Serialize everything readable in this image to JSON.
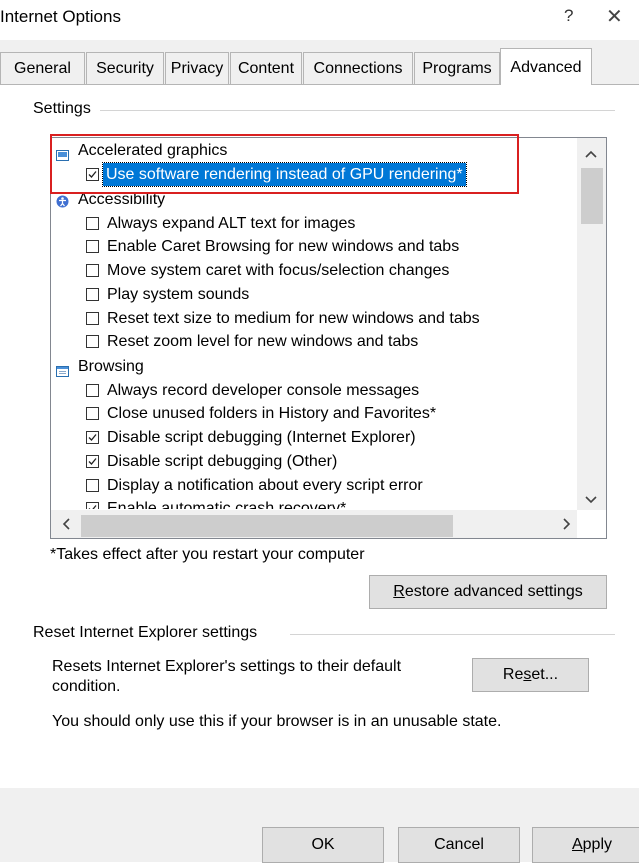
{
  "window": {
    "title": "Internet Options",
    "help_glyph": "?",
    "close_glyph": "✕"
  },
  "tabs": [
    {
      "label": "General"
    },
    {
      "label": "Security"
    },
    {
      "label": "Privacy"
    },
    {
      "label": "Content"
    },
    {
      "label": "Connections"
    },
    {
      "label": "Programs"
    },
    {
      "label": "Advanced",
      "active": true
    }
  ],
  "settings_group": {
    "label": "Settings",
    "categories": [
      {
        "label": "Accelerated graphics",
        "icon": "monitor-icon",
        "items": [
          {
            "label": "Use software rendering instead of GPU rendering*",
            "checked": true,
            "selected": true
          }
        ]
      },
      {
        "label": "Accessibility",
        "icon": "accessibility-icon",
        "items": [
          {
            "label": "Always expand ALT text for images",
            "checked": false
          },
          {
            "label": "Enable Caret Browsing for new windows and tabs",
            "checked": false
          },
          {
            "label": "Move system caret with focus/selection changes",
            "checked": false
          },
          {
            "label": "Play system sounds",
            "checked": false
          },
          {
            "label": "Reset text size to medium for new windows and tabs",
            "checked": false
          },
          {
            "label": "Reset zoom level for new windows and tabs",
            "checked": false
          }
        ]
      },
      {
        "label": "Browsing",
        "icon": "browsing-icon",
        "items": [
          {
            "label": "Always record developer console messages",
            "checked": false
          },
          {
            "label": "Close unused folders in History and Favorites*",
            "checked": false
          },
          {
            "label": "Disable script debugging (Internet Explorer)",
            "checked": true
          },
          {
            "label": "Disable script debugging (Other)",
            "checked": true
          },
          {
            "label": "Display a notification about every script error",
            "checked": false
          },
          {
            "label": "Enable automatic crash recovery*",
            "checked": true
          }
        ]
      }
    ],
    "footnote": "*Takes effect after you restart your computer",
    "restore_button": {
      "mnemonic": "R",
      "rest": "estore advanced settings"
    }
  },
  "reset_group": {
    "label": "Reset Internet Explorer settings",
    "description": "Resets Internet Explorer's settings to their default condition.",
    "reset_button": {
      "before": "Re",
      "mnemonic": "s",
      "after": "et..."
    },
    "warning": "You should only use this if your browser is in an unusable state."
  },
  "footer": {
    "ok_label": "OK",
    "cancel_label": "Cancel",
    "apply_mnemonic": "A",
    "apply_rest": "pply"
  },
  "colors": {
    "selection": "#0078d7",
    "annotation": "#d92020",
    "dialog_bg": "#f0f0f0"
  }
}
